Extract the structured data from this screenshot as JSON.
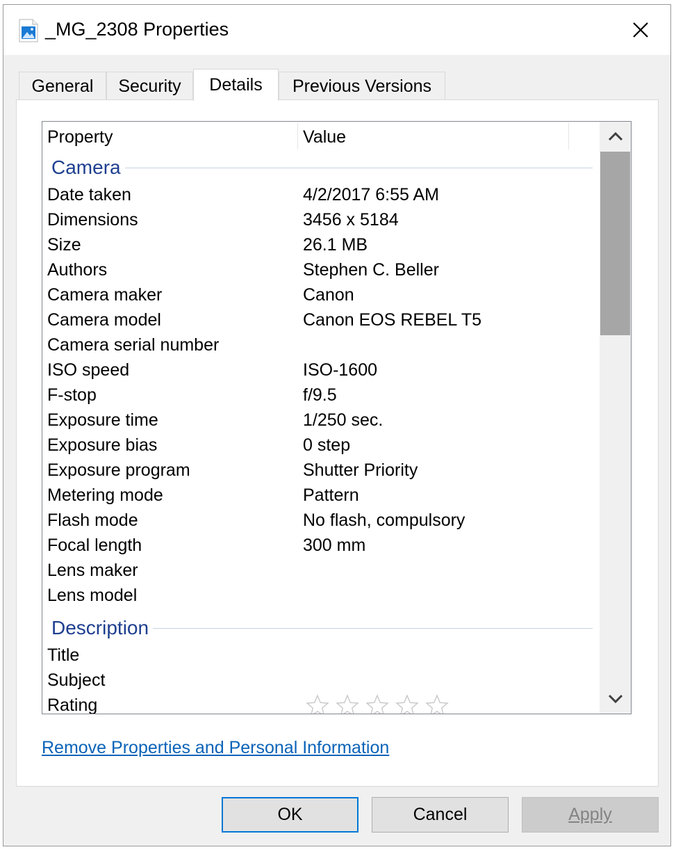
{
  "window": {
    "title": "_MG_2308 Properties",
    "icon": "image-file-icon",
    "close_icon": "close-icon"
  },
  "tabs": [
    {
      "label": "General",
      "active": false
    },
    {
      "label": "Security",
      "active": false
    },
    {
      "label": "Details",
      "active": true
    },
    {
      "label": "Previous Versions",
      "active": false
    }
  ],
  "details": {
    "columns": {
      "property": "Property",
      "value": "Value"
    },
    "groups": [
      {
        "title": "Camera",
        "rows": [
          {
            "property": "Date taken",
            "value": "4/2/2017 6:55 AM"
          },
          {
            "property": "Dimensions",
            "value": "3456 x 5184"
          },
          {
            "property": "Size",
            "value": "26.1 MB"
          },
          {
            "property": "Authors",
            "value": "Stephen C. Beller"
          },
          {
            "property": "Camera maker",
            "value": "Canon"
          },
          {
            "property": "Camera model",
            "value": "Canon EOS REBEL T5"
          },
          {
            "property": "Camera serial number",
            "value": ""
          },
          {
            "property": "ISO speed",
            "value": "ISO-1600"
          },
          {
            "property": "F-stop",
            "value": "f/9.5"
          },
          {
            "property": "Exposure time",
            "value": "1/250 sec."
          },
          {
            "property": "Exposure bias",
            "value": "0 step"
          },
          {
            "property": "Exposure program",
            "value": "Shutter Priority"
          },
          {
            "property": "Metering mode",
            "value": "Pattern"
          },
          {
            "property": "Flash mode",
            "value": "No flash, compulsory"
          },
          {
            "property": "Focal length",
            "value": "300 mm"
          },
          {
            "property": "Lens maker",
            "value": ""
          },
          {
            "property": "Lens model",
            "value": ""
          }
        ]
      },
      {
        "title": "Description",
        "rows": [
          {
            "property": "Title",
            "value": ""
          },
          {
            "property": "Subject",
            "value": ""
          },
          {
            "property": "Rating",
            "value": ""
          }
        ]
      }
    ],
    "rating": {
      "stars_filled": 0,
      "stars_total": 5
    }
  },
  "links": {
    "remove_properties": "Remove Properties and Personal Information"
  },
  "buttons": {
    "ok": "OK",
    "cancel": "Cancel",
    "apply": "Apply"
  },
  "colors": {
    "group_title": "#1e3f8f",
    "link": "#0b63b8",
    "ok_border": "#0078d7",
    "scroll_thumb": "#a6a6a6"
  }
}
